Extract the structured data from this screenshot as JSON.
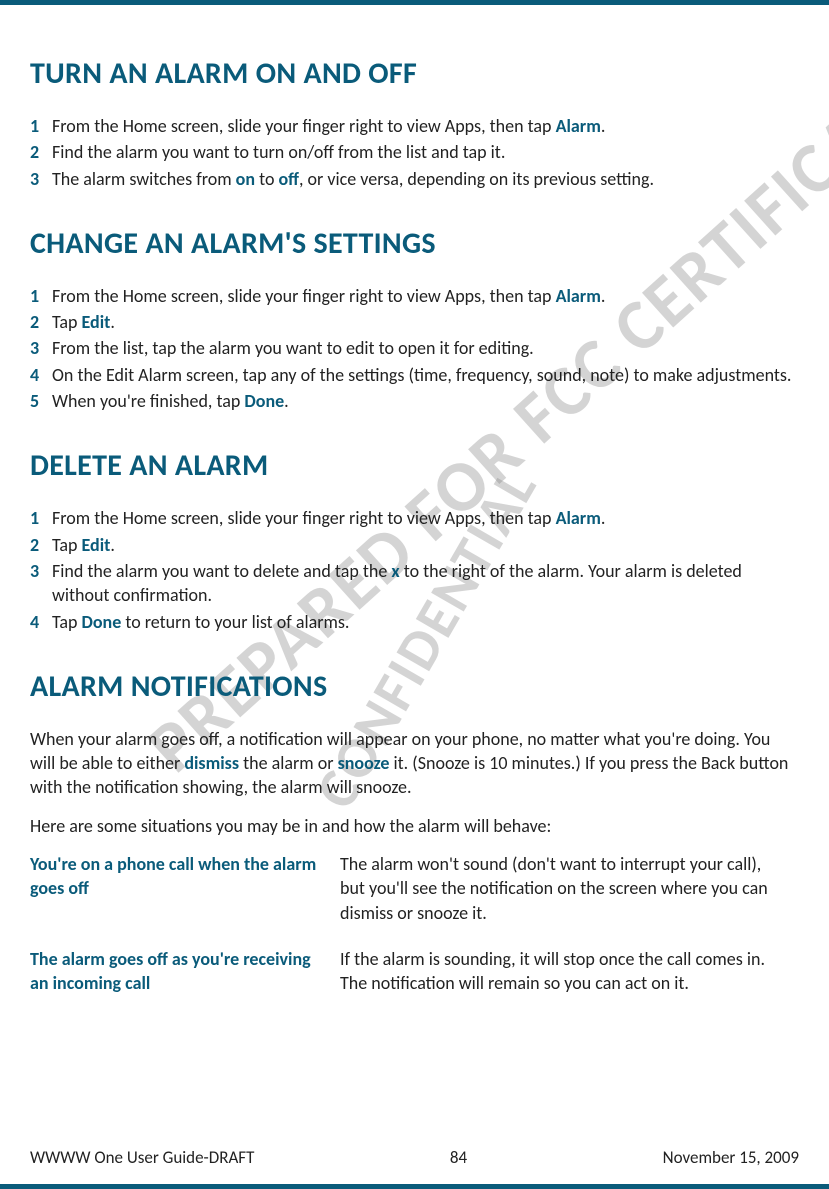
{
  "watermarks": {
    "line1": "PREPARED FOR FCC CERTIFICATION",
    "line2": "CONFIDENTIAL"
  },
  "sections": {
    "turn_on_off": {
      "title": "TURN AN ALARM ON AND OFF",
      "steps": [
        {
          "pre": "From the Home screen, slide your finger right to view Apps, then tap ",
          "bold": "Alarm",
          "post": "."
        },
        {
          "pre": "Find the alarm you want to turn on/off from the list and tap it.",
          "bold": "",
          "post": ""
        },
        {
          "pre": "The alarm switches from ",
          "bold": "on",
          "mid": " to ",
          "bold2": "off",
          "post": ", or vice versa, depending on its previous setting."
        }
      ]
    },
    "change_settings": {
      "title": "CHANGE AN ALARM'S SETTINGS",
      "steps": [
        {
          "pre": "From the Home screen, slide your finger right to view Apps, then tap ",
          "bold": "Alarm",
          "post": "."
        },
        {
          "pre": "Tap ",
          "bold": "Edit",
          "post": "."
        },
        {
          "pre": "From the list, tap the alarm you want to edit to open it for editing.",
          "bold": "",
          "post": ""
        },
        {
          "pre": "On the Edit Alarm screen, tap any of the settings (time, frequency, sound, note) to make adjustments.",
          "bold": "",
          "post": ""
        },
        {
          "pre": "When you're finished, tap ",
          "bold": "Done",
          "post": "."
        }
      ]
    },
    "delete_alarm": {
      "title": "DELETE AN ALARM",
      "steps": [
        {
          "pre": "From the Home screen, slide your finger right to view Apps, then tap ",
          "bold": "Alarm",
          "post": "."
        },
        {
          "pre": "Tap ",
          "bold": "Edit",
          "post": "."
        },
        {
          "pre": "Find the alarm you want to delete and tap the ",
          "bold": "x",
          "post": " to the right of the alarm. Your alarm is deleted without confirmation."
        },
        {
          "pre": "Tap ",
          "bold": "Done",
          "post": " to return to your list of alarms."
        }
      ]
    },
    "notifications": {
      "title": "ALARM NOTIFICATIONS",
      "para1_pre": "When your alarm goes off, a notification will appear on your phone, no matter what you're doing. You will be able to either ",
      "para1_bold1": "dismiss",
      "para1_mid": " the alarm or ",
      "para1_bold2": "snooze",
      "para1_post": " it. (Snooze is 10 minutes.) If you press the Back button with the notification showing, the alarm will snooze.",
      "para2": "Here are some situations you may be in and how the alarm will behave:",
      "rows": [
        {
          "label": "You're on a phone call when the alarm goes off",
          "desc": "The alarm won't sound (don't want to interrupt your call), but you'll see the notification on the screen where you can dismiss or snooze it."
        },
        {
          "label": "The alarm goes off as you're receiving an incoming call",
          "desc": "If the alarm is sounding, it will stop once the call comes in. The notification will remain so you can act on it."
        }
      ]
    }
  },
  "footer": {
    "left": "WWWW One User Guide-DRAFT",
    "center": "84",
    "right": "November 15, 2009"
  }
}
